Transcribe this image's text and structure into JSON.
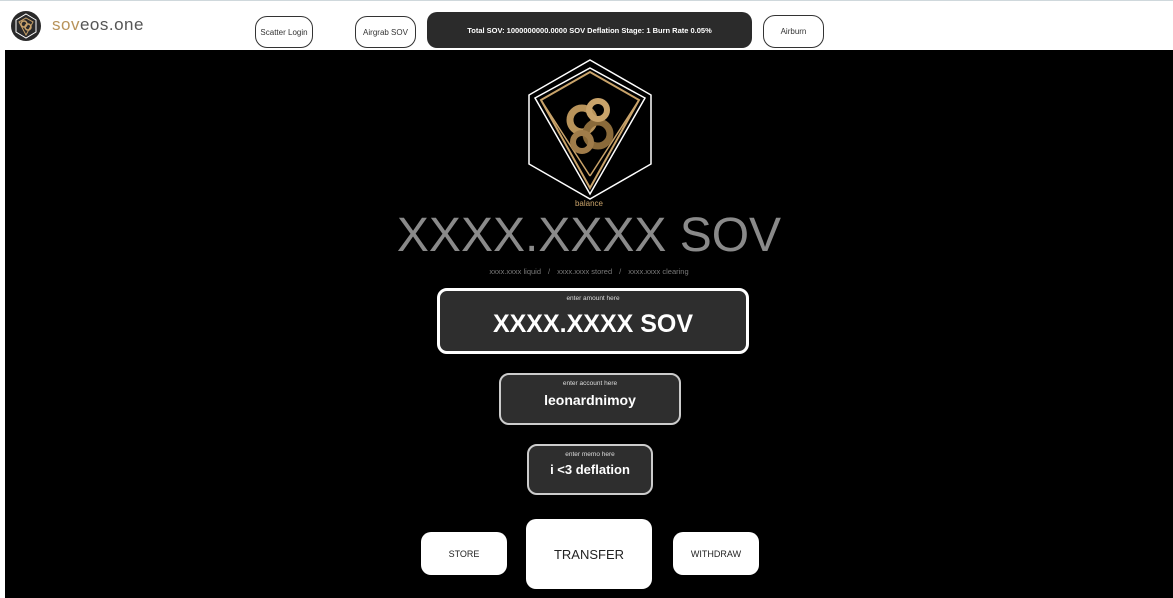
{
  "header": {
    "brand_part1": "sov",
    "brand_part2": "eos.one",
    "scatter_login": "Scatter Login",
    "airgrab": "Airgrab SOV",
    "stats": "Total SOV: 1000000000.0000 SOV Deflation Stage: 1 Burn Rate 0.05%",
    "airburn": "Airburn"
  },
  "balance": {
    "label": "balance",
    "value": "XXXX.XXXX SOV",
    "liquid": "xxxx.xxxx liquid",
    "stored": "xxxx.xxxx stored",
    "clearing": "xxxx.xxxx clearing",
    "separator": "/"
  },
  "form": {
    "amount_hint": "enter amount here",
    "amount_value": "XXXX.XXXX SOV",
    "account_hint": "enter account here",
    "account_value": "leonardnimoy",
    "memo_hint": "enter memo here",
    "memo_value": "i <3 deflation"
  },
  "actions": {
    "store": "STORE",
    "transfer": "TRANSFER",
    "withdraw": "WITHDRAW"
  },
  "colors": {
    "gold": "#c9a36a",
    "background": "#000000",
    "field_bg": "#2e2e2e"
  },
  "icons": {
    "logo": "sov-emblem-icon"
  }
}
